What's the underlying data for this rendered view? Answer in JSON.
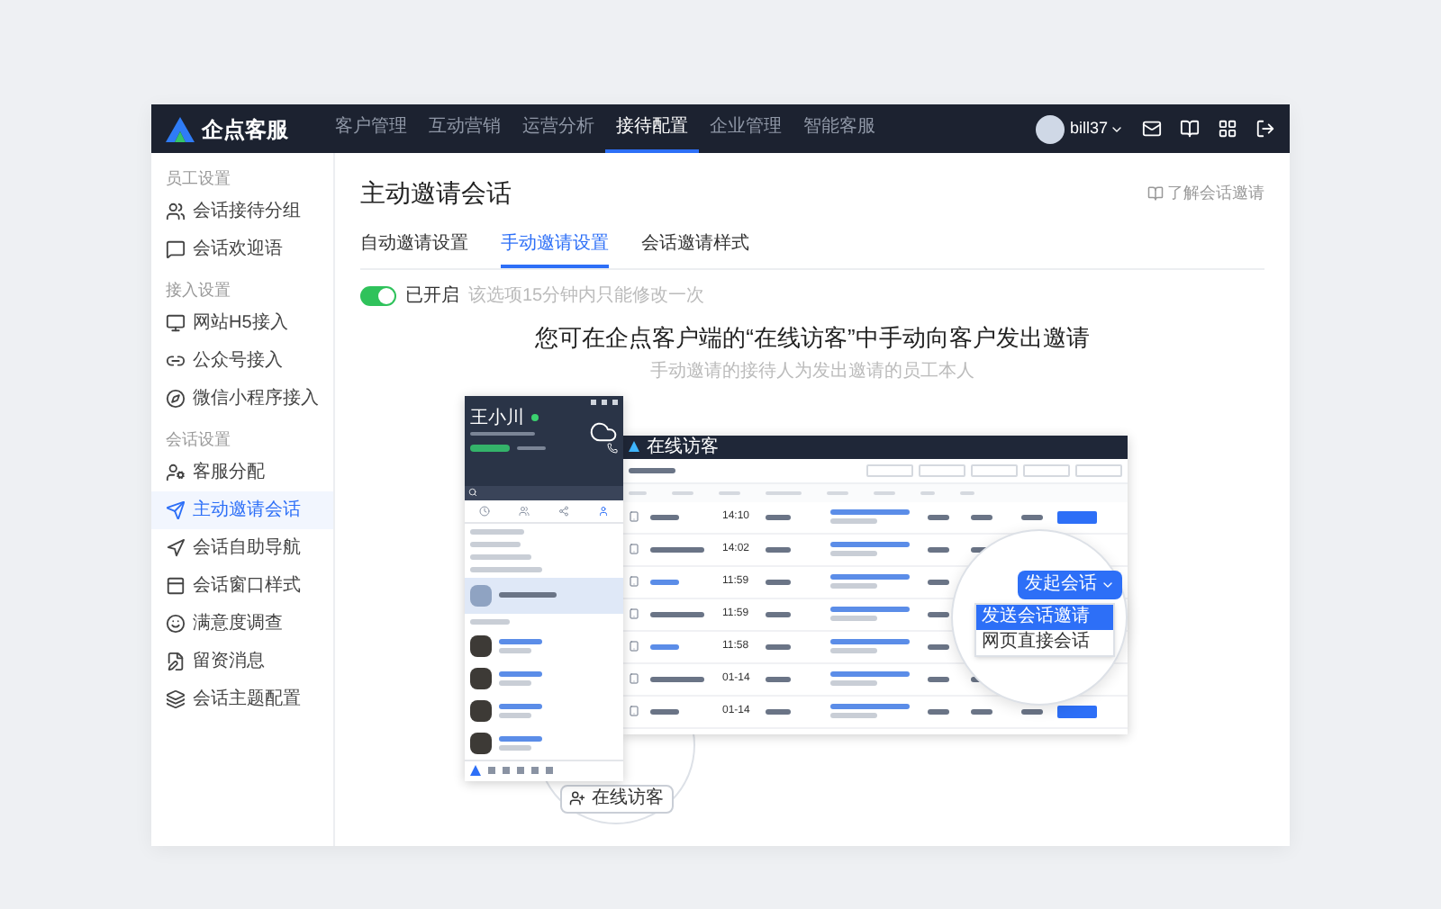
{
  "app": {
    "logo": "企点客服",
    "nav": [
      {
        "label": "客户管理",
        "selected": false
      },
      {
        "label": "互动营销",
        "selected": false
      },
      {
        "label": "运营分析",
        "selected": false
      },
      {
        "label": "接待配置",
        "selected": true
      },
      {
        "label": "企业管理",
        "selected": false
      },
      {
        "label": "智能客服",
        "selected": false
      }
    ],
    "user": "bill37"
  },
  "sidebar": [
    {
      "title": "员工设置",
      "items": [
        {
          "label": "会话接待分组",
          "selected": false
        },
        {
          "label": "会话欢迎语",
          "selected": false
        }
      ]
    },
    {
      "title": "接入设置",
      "items": [
        {
          "label": "网站H5接入",
          "selected": false
        },
        {
          "label": "公众号接入",
          "selected": false
        },
        {
          "label": "微信小程序接入",
          "selected": false
        }
      ]
    },
    {
      "title": "会话设置",
      "items": [
        {
          "label": "客服分配",
          "selected": false
        },
        {
          "label": "主动邀请会话",
          "selected": true
        },
        {
          "label": "会话自助导航",
          "selected": false
        },
        {
          "label": "会话窗口样式",
          "selected": false
        },
        {
          "label": "满意度调查",
          "selected": false
        },
        {
          "label": "留资消息",
          "selected": false
        },
        {
          "label": "会话主题配置",
          "selected": false
        }
      ]
    }
  ],
  "page": {
    "title": "主动邀请会话",
    "help_link": "了解会话邀请",
    "tabs": [
      {
        "label": "自动邀请设置",
        "selected": false
      },
      {
        "label": "手动邀请设置",
        "selected": true
      },
      {
        "label": "会话邀请样式",
        "selected": false
      }
    ],
    "toggle": {
      "on": true,
      "label": "已开启",
      "hint": "该选项15分钟内只能修改一次"
    },
    "headline": "您可在企点客户端的“在线访客”中手动向客户发出邀请",
    "subline": "手动邀请的接待人为发出邀请的员工本人"
  },
  "preview": {
    "contact_panel": {
      "name": "王小川"
    },
    "visitor_window": {
      "title": "在线访客",
      "rows": [
        {
          "time": "14:10"
        },
        {
          "time": "14:02"
        },
        {
          "time": "11:59"
        },
        {
          "time": "11:59"
        },
        {
          "time": "11:58"
        },
        {
          "time": "01-14"
        },
        {
          "time": "01-14"
        }
      ]
    },
    "zoom_menu": {
      "button": "发起会话",
      "items": [
        {
          "label": "发送会话邀请",
          "selected": true
        },
        {
          "label": "网页直接会话",
          "selected": false
        }
      ]
    },
    "zoom_button": {
      "label": "在线访客"
    }
  }
}
